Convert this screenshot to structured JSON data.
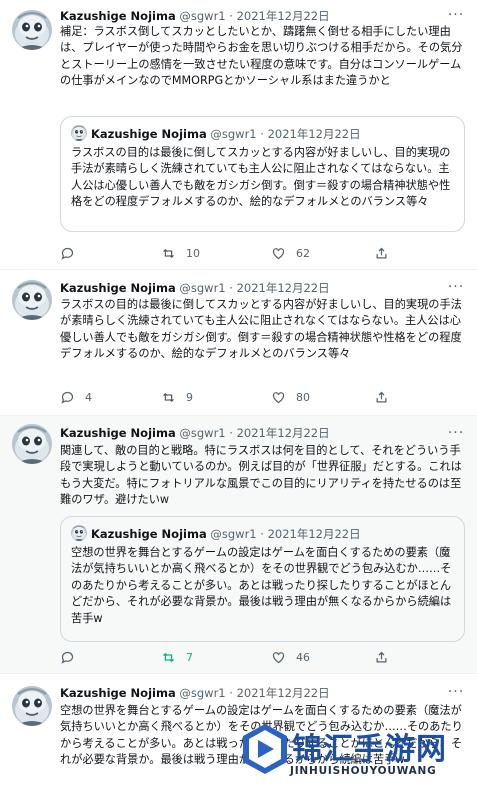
{
  "tweets": [
    {
      "name": "Kazushige Nojima",
      "handle": "@sgwr1",
      "date": "2021年12月22日",
      "text": "補足：ラスボス倒してスカッとしたいとか、躊躇無く倒せる相手にしたい理由は、プレイヤーが使った時間やらお金を思い切りぶつける相手だから。その気分とストーリー上の感情を一致させたい程度の意味です。自分はコンソールゲームの仕事がメインなのでMMORPGとかソーシャル系はまた違うかと",
      "quote": {
        "name": "Kazushige Nojima",
        "handle": "@sgwr1",
        "date": "2021年12月22日",
        "text": "ラスボスの目的は最後に倒してスカッとする内容が好ましいし、目的実現の手法が素晴らしく洗練されていても主人公に阻止されなくてはならない。主人公は心優しい善人でも敵をガシガシ倒す。倒す＝殺すの場合精神状態や性格をどの程度デフォルメするのか、絵的なデフォルメとのバランス等々"
      },
      "reply_count": "",
      "retweet_count": "10",
      "like_count": "62"
    },
    {
      "name": "Kazushige Nojima",
      "handle": "@sgwr1",
      "date": "2021年12月22日",
      "text": "ラスボスの目的は最後に倒してスカッとする内容が好ましいし、目的実現の手法が素晴らしく洗練されていても主人公に阻止されなくてはならない。主人公は心優しい善人でも敵をガシガシ倒す。倒す＝殺すの場合精神状態や性格をどの程度デフォルメするのか、絵的なデフォルメとのバランス等々",
      "reply_count": "4",
      "retweet_count": "9",
      "like_count": "80"
    },
    {
      "name": "Kazushige Nojima",
      "handle": "@sgwr1",
      "date": "2021年12月22日",
      "text": "関連して、敵の目的と戦略。特にラスボスは何を目的として、それをどういう手段で実現しようと動いているのか。例えば目的が「世界征服」だとする。これはもう大変だ。特にフォトリアルな風景でこの目的にリアリティを持たせるのは至難のワザ。避けたいw",
      "quote": {
        "name": "Kazushige Nojima",
        "handle": "@sgwr1",
        "date": "2021年12月22日",
        "text": "空想の世界を舞台とするゲームの設定はゲームを面白くするための要素（魔法が気持ちいいとか高く飛べるとか）をその世界観でどう包み込むか……そのあたりから考えることが多い。あとは戦ったり探したりすることがほとんどだから、それが必要な背景か。最後は戦う理由が無くなるからから続編は苦手w"
      },
      "reply_count": "",
      "retweet_count": "7",
      "like_count": "46"
    },
    {
      "name": "Kazushige Nojima",
      "handle": "@sgwr1",
      "date": "2021年12月22日",
      "text": "空想の世界を舞台とするゲームの設定はゲームを面白くするための要素（魔法が気持ちいいとか高く飛べるとか）をその世界観でどう包み込むか……そのあたりから考えることが多い。あとは戦ったり探したりすることがほとんどだから、それが必要な背景か。最後は戦う理由が無くなるからから続編は苦手w"
    }
  ],
  "separator": "·",
  "more_glyph": "···",
  "icons": [
    "reply-icon",
    "retweet-icon",
    "like-icon",
    "share-icon",
    "more-icon"
  ],
  "colors": {
    "retweet_active": "#00ba7c",
    "text": "#0f1419",
    "muted": "#536471",
    "watermark_blue": "#1d4fa0"
  },
  "watermark": {
    "title": "锦汇手游网",
    "subtitle": "JINHUISHOUYOUWANG"
  }
}
